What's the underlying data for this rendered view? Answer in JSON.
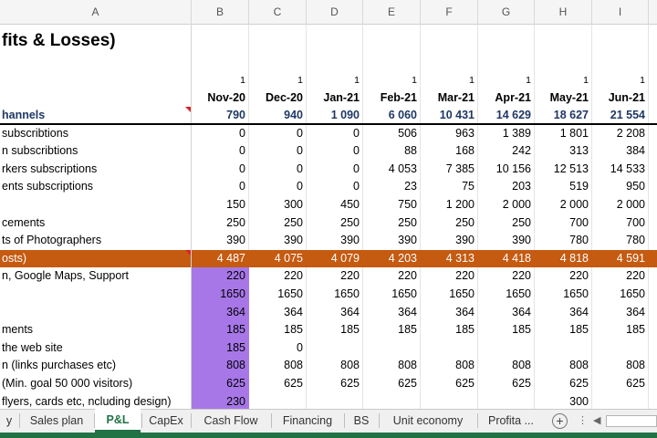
{
  "colheaders": [
    "A",
    "B",
    "C",
    "D",
    "E",
    "F",
    "G",
    "H",
    "I"
  ],
  "title": "fits & Losses)",
  "months_flag": [
    "1",
    "1",
    "1",
    "1",
    "1",
    "1",
    "1",
    "1"
  ],
  "months": [
    "Nov-20",
    "Dec-20",
    "Jan-21",
    "Feb-21",
    "Mar-21",
    "Apr-21",
    "May-21",
    "Jun-21"
  ],
  "rows": [
    {
      "label": "hannels",
      "values": [
        "790",
        "940",
        "1 090",
        "6 060",
        "10 431",
        "14 629",
        "18 627",
        "21 554"
      ]
    },
    {
      "label": "subscribtions",
      "values": [
        "0",
        "0",
        "0",
        "506",
        "963",
        "1 389",
        "1 801",
        "2 208"
      ]
    },
    {
      "label": "n subscribtions",
      "values": [
        "0",
        "0",
        "0",
        "88",
        "168",
        "242",
        "313",
        "384"
      ]
    },
    {
      "label": "rkers subscriptions",
      "values": [
        "0",
        "0",
        "0",
        "4 053",
        "7 385",
        "10 156",
        "12 513",
        "14 533"
      ]
    },
    {
      "label": "ents subscriptions",
      "values": [
        "0",
        "0",
        "0",
        "23",
        "75",
        "203",
        "519",
        "950"
      ]
    },
    {
      "label": "",
      "values": [
        "150",
        "300",
        "450",
        "750",
        "1 200",
        "2 000",
        "2 000",
        "2 000"
      ]
    },
    {
      "label": "cements",
      "values": [
        "250",
        "250",
        "250",
        "250",
        "250",
        "250",
        "700",
        "700"
      ]
    },
    {
      "label": "ts of Photographers",
      "values": [
        "390",
        "390",
        "390",
        "390",
        "390",
        "390",
        "780",
        "780"
      ]
    },
    {
      "label": "osts)",
      "values": [
        "4 487",
        "4 075",
        "4 079",
        "4 203",
        "4 313",
        "4 418",
        "4 818",
        "4 591"
      ]
    },
    {
      "label": "n, Google Maps, Support",
      "values": [
        "220",
        "220",
        "220",
        "220",
        "220",
        "220",
        "220",
        "220"
      ]
    },
    {
      "label": "",
      "values": [
        "1650",
        "1650",
        "1650",
        "1650",
        "1650",
        "1650",
        "1650",
        "1650"
      ]
    },
    {
      "label": "",
      "values": [
        "364",
        "364",
        "364",
        "364",
        "364",
        "364",
        "364",
        "364"
      ]
    },
    {
      "label": "ments",
      "values": [
        "185",
        "185",
        "185",
        "185",
        "185",
        "185",
        "185",
        "185"
      ]
    },
    {
      "label": "the web site",
      "values": [
        "185",
        "0",
        "",
        "",
        "",
        "",
        "",
        ""
      ]
    },
    {
      "label": "n (links purchases etc)",
      "values": [
        "808",
        "808",
        "808",
        "808",
        "808",
        "808",
        "808",
        "808"
      ]
    },
    {
      "label": "(Min. goal 50 000 visitors)",
      "values": [
        "625",
        "625",
        "625",
        "625",
        "625",
        "625",
        "625",
        "625"
      ]
    },
    {
      "label": "flyers, cards etc, ncluding design)",
      "values": [
        "230",
        "",
        "",
        "",
        "",
        "",
        "300",
        ""
      ]
    }
  ],
  "tabs": [
    "y",
    "Sales plan",
    "P&L",
    "CapEx",
    "Cash Flow",
    "Financing",
    "BS",
    "Unit economy",
    "Profita ..."
  ],
  "active_tab": "P&L",
  "colors": {
    "accent": "#217346",
    "costs_row": "#c55a11",
    "highlight": "#a777e8",
    "channel_text": "#1f3864"
  }
}
